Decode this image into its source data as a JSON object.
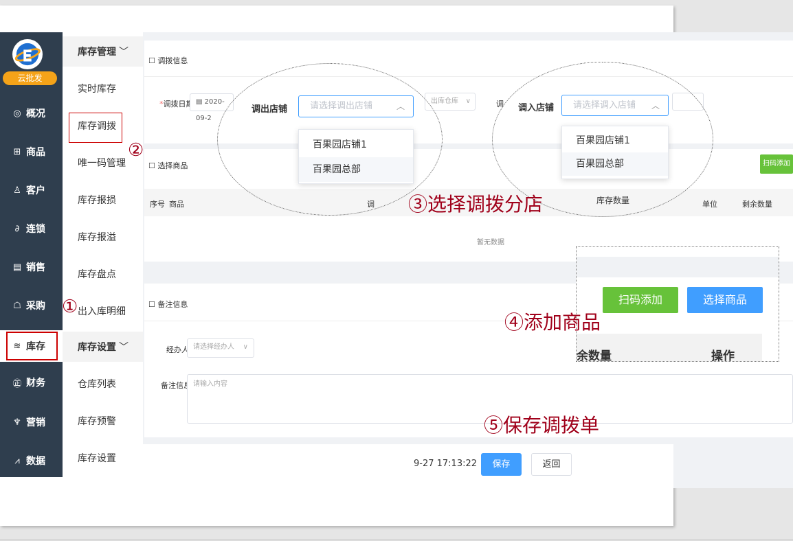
{
  "brand": {
    "name": "云批发"
  },
  "sidebar": {
    "items": [
      {
        "icon": "◎",
        "label": "概况"
      },
      {
        "icon": "⊞",
        "label": "商品"
      },
      {
        "icon": "♙",
        "label": "客户"
      },
      {
        "icon": "∂",
        "label": "连锁"
      },
      {
        "icon": "▤",
        "label": "销售"
      },
      {
        "icon": "☖",
        "label": "采购"
      },
      {
        "icon": "≋",
        "label": "库存"
      },
      {
        "icon": "㊣",
        "label": "财务"
      },
      {
        "icon": "♆",
        "label": "营销"
      },
      {
        "icon": "⩘",
        "label": "数据"
      }
    ]
  },
  "submenu": {
    "group1": "库存管理",
    "items1": [
      "实时库存",
      "库存调拨",
      "唯一码管理",
      "库存报损",
      "库存报溢",
      "库存盘点",
      "出入库明细"
    ],
    "group2": "库存设置",
    "items2": [
      "仓库列表",
      "库存预警",
      "库存设置"
    ]
  },
  "transfer_panel": {
    "title": "调拨信息",
    "date_label": "调拨日期",
    "date_value": "2020-09-2",
    "out_placeholder_bg": "出库仓库",
    "in_label_bg": "调"
  },
  "goods_panel": {
    "title": "选择商品",
    "scan_btn": "扫码添加",
    "columns": [
      "序号",
      "商品",
      "调",
      "库存数量",
      "单位",
      "剩余数量"
    ],
    "empty": "暂无数据"
  },
  "remark_panel": {
    "title": "备注信息",
    "handler_label": "经办人",
    "handler_placeholder": "请选择经办人",
    "remark_label": "备注信息",
    "remark_placeholder": "请输入内容"
  },
  "out_store": {
    "label": "调出店铺",
    "placeholder": "请选择调出店铺",
    "options": [
      "百果园店铺1",
      "百果园总部"
    ]
  },
  "in_store": {
    "label": "调入店铺",
    "placeholder": "请选择调入店铺",
    "options": [
      "百果园店铺1",
      "百果园总部"
    ]
  },
  "overlay": {
    "scan_btn": "扫码添加",
    "select_btn": "选择商品",
    "col_remaining": "余数量",
    "col_action": "操作"
  },
  "annotations": {
    "a1": "①",
    "a2": "②",
    "a3": "③选择调拨分店",
    "a4": "④添加商品",
    "a5": "⑤保存调拨单"
  },
  "footer": {
    "time": "9-27 17:13:22",
    "save": "保存",
    "back": "返回"
  },
  "colors": {
    "sidebar": "#2f3e4e",
    "brand": "#f5a319",
    "primary": "#409eff",
    "success": "#67c23a",
    "annotation": "#a0001a"
  }
}
